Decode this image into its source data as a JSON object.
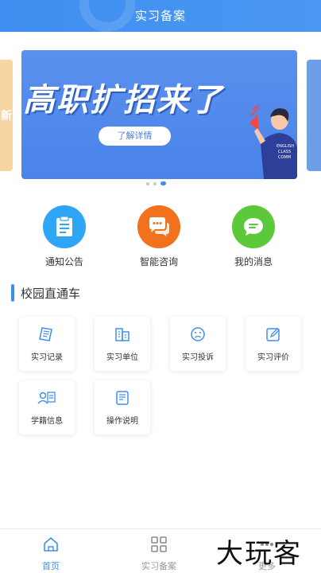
{
  "header": {
    "title": "实习备案"
  },
  "banner": {
    "headline": "高职扩招来了",
    "button_label": "了解详情",
    "left_card_text": "新",
    "slide_count": 3,
    "active_slide": 3
  },
  "quick_actions": [
    {
      "label": "通知公告",
      "icon": "document-icon",
      "color": "#2fa5f5"
    },
    {
      "label": "智能咨询",
      "icon": "chat-bubble-icon",
      "color": "#f2711c"
    },
    {
      "label": "我的消息",
      "icon": "message-icon",
      "color": "#5cc93a"
    }
  ],
  "section": {
    "title": "校园直通车"
  },
  "services": [
    {
      "label": "实习记录",
      "icon": "notebook-icon"
    },
    {
      "label": "实习单位",
      "icon": "building-icon"
    },
    {
      "label": "实习投诉",
      "icon": "sad-face-icon"
    },
    {
      "label": "实习评价",
      "icon": "edit-icon"
    },
    {
      "label": "学籍信息",
      "icon": "student-card-icon"
    },
    {
      "label": "操作说明",
      "icon": "manual-icon"
    }
  ],
  "tabbar": {
    "items": [
      {
        "label": "首页",
        "icon": "home-icon",
        "active": true
      },
      {
        "label": "实习备案",
        "icon": "grid-icon",
        "active": false
      },
      {
        "label": "更多",
        "icon": "more-icon",
        "active": false
      }
    ]
  },
  "watermark": {
    "text": "大玩客"
  },
  "colors": {
    "primary": "#3f8ff0",
    "banner": "#5a90ee"
  }
}
